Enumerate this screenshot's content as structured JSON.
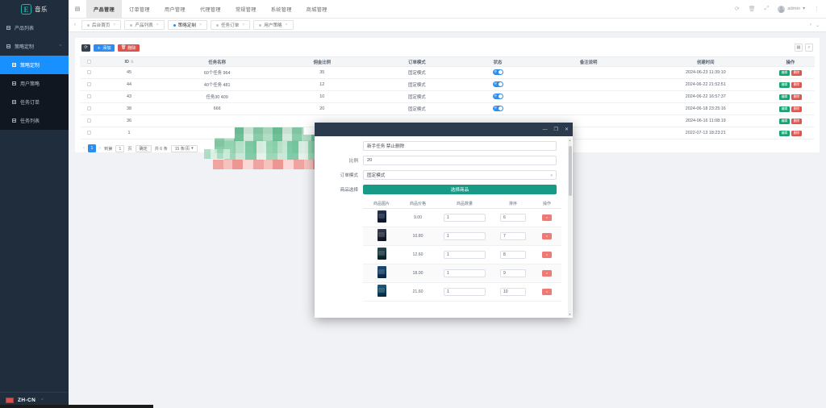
{
  "app": {
    "logo_letter": "E",
    "logo_text": "音乐"
  },
  "topnav": {
    "hamburger_icon": "menu-icon",
    "items": [
      {
        "label": "产品管理",
        "active": true
      },
      {
        "label": "订单管理",
        "active": false
      },
      {
        "label": "用户管理",
        "active": false
      },
      {
        "label": "代理管理",
        "active": false
      },
      {
        "label": "常规管理",
        "active": false
      },
      {
        "label": "系统管理",
        "active": false
      },
      {
        "label": "商城管理",
        "active": false
      }
    ],
    "right_icons": [
      "refresh-icon",
      "trash-icon",
      "fullscreen-icon"
    ],
    "user_name": "admin",
    "user_caret": "▾",
    "more_icon": "⋮"
  },
  "sidebar": {
    "items": [
      {
        "label": "产品列表",
        "active": false,
        "expandable": false
      },
      {
        "label": "策略定制",
        "active": false,
        "expandable": true,
        "caret": "⌃"
      }
    ],
    "sub_items": [
      {
        "label": "策略定制",
        "active": true
      },
      {
        "label": "用户策略",
        "active": false
      },
      {
        "label": "任务订单",
        "active": false
      },
      {
        "label": "任务列表",
        "active": false
      }
    ],
    "language": {
      "code": "ZH-CN",
      "caret": "⌃",
      "flag_color": "#d8504a"
    }
  },
  "tabbar": {
    "back_arrow": "‹",
    "forward_arrow": "›",
    "collapse_arrow": "⌄",
    "tabs": [
      {
        "label": "后台首页",
        "active": false,
        "closable": true
      },
      {
        "label": "产品列表",
        "active": false,
        "closable": true
      },
      {
        "label": "策略定制",
        "active": true,
        "closable": true
      },
      {
        "label": "任务订单",
        "active": false,
        "closable": true
      },
      {
        "label": "用户策略",
        "active": false,
        "closable": true
      }
    ]
  },
  "toolbar": {
    "refresh_icon": "refresh-icon",
    "add_label": "添加",
    "delete_label": "删除",
    "columns_icon": "columns-icon",
    "search_icon": "search-icon"
  },
  "table": {
    "columns": [
      "ID",
      "任务名称",
      "佣金比例",
      "订单模式",
      "状态",
      "备注说明",
      "创建时间",
      "操作"
    ],
    "rows": [
      {
        "id": "45",
        "name": "60个任务 964",
        "rate": "35",
        "mode": "固定模式",
        "status_on": true,
        "status_label": "开",
        "note": "",
        "created": "2024-06-23 11:39:10",
        "edit_label": "编辑",
        "delete_label": "删除"
      },
      {
        "id": "44",
        "name": "40个任务 481",
        "rate": "12",
        "mode": "固定模式",
        "status_on": true,
        "status_label": "开",
        "note": "",
        "created": "2024-06-22 21:52:51",
        "edit_label": "编辑",
        "delete_label": "删除"
      },
      {
        "id": "43",
        "name": "任务30 409",
        "rate": "10",
        "mode": "固定模式",
        "status_on": true,
        "status_label": "开",
        "note": "",
        "created": "2024-06-22 16:57:37",
        "edit_label": "编辑",
        "delete_label": "删除"
      },
      {
        "id": "38",
        "name": "666",
        "rate": "20",
        "mode": "固定模式",
        "status_on": true,
        "status_label": "开",
        "note": "",
        "created": "2024-06-18 23:25:16",
        "edit_label": "编辑",
        "delete_label": "删除"
      },
      {
        "id": "36",
        "name": "",
        "rate": "",
        "mode": "",
        "status_on": false,
        "status_label": "",
        "note": "",
        "created": "2024-06-16 11:08:19",
        "edit_label": "编辑",
        "delete_label": "删除"
      },
      {
        "id": "1",
        "name": "",
        "rate": "",
        "mode": "",
        "status_on": false,
        "status_label": "",
        "note": "",
        "created": "2022-07-13 18:23:21",
        "edit_label": "编辑",
        "delete_label": "删除"
      }
    ]
  },
  "pagination": {
    "prev": "‹",
    "next": "›",
    "current_page": "1",
    "goto_prefix": "到第",
    "goto_value": "1",
    "goto_suffix": "页",
    "confirm_label": "确定",
    "total_label": "共 6 条",
    "page_size_label": "15 条/页",
    "page_size_caret": "▾"
  },
  "modal": {
    "title": "",
    "minimize_icon": "minimize-icon",
    "maximize_icon": "maximize-icon",
    "close_icon": "close-icon",
    "fields": [
      {
        "label": "",
        "value": "新手任务 禁止删除",
        "type": "text"
      },
      {
        "label": "比例",
        "value": "20",
        "type": "text"
      },
      {
        "label": "订单模式",
        "value": "固定模式",
        "type": "select",
        "caret": "▾"
      },
      {
        "label": "商品选择",
        "value": "选择商品",
        "type": "button"
      }
    ],
    "goods_table": {
      "columns": [
        "商品图片",
        "商品价格",
        "商品数量",
        "排序",
        "操作"
      ],
      "rows": [
        {
          "thumb": "poster-thumb-1",
          "price": "9.00",
          "qty": "1",
          "order": "6",
          "delete_label": "×"
        },
        {
          "thumb": "poster-thumb-2",
          "price": "10.80",
          "qty": "1",
          "order": "7",
          "delete_label": "×"
        },
        {
          "thumb": "poster-thumb-3",
          "price": "12.60",
          "qty": "1",
          "order": "8",
          "delete_label": "×"
        },
        {
          "thumb": "poster-thumb-4",
          "price": "18.00",
          "qty": "1",
          "order": "9",
          "delete_label": "×"
        },
        {
          "thumb": "poster-thumb-5",
          "price": "21.60",
          "qty": "1",
          "order": "10",
          "delete_label": "×"
        }
      ]
    },
    "scroll_up": "▴",
    "scroll_down": "▾"
  },
  "colors": {
    "sidebar_bg": "#1f2d3d",
    "accent_blue": "#2d8cf0",
    "accent_teal": "#179b87",
    "danger_red": "#d9544f",
    "success_green": "#19a371"
  }
}
